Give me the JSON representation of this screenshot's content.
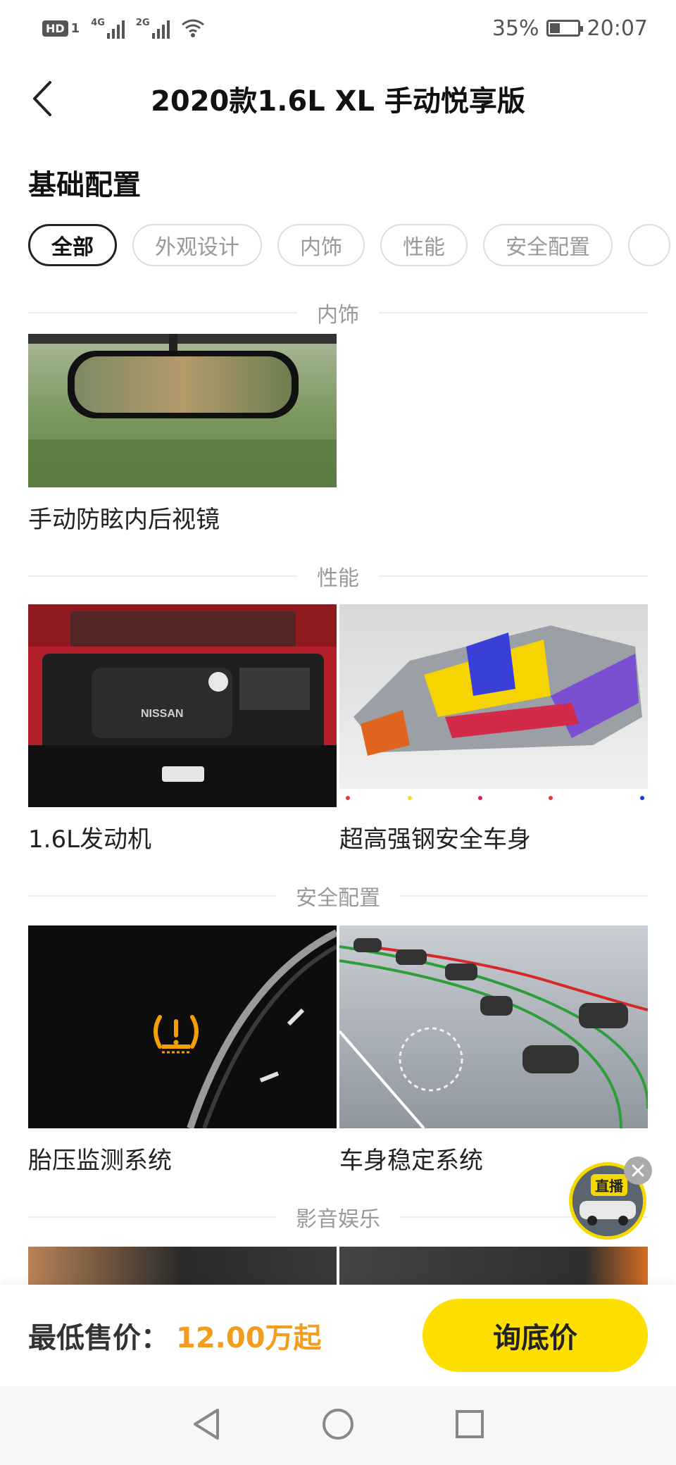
{
  "status_bar": {
    "hd": "HD",
    "sim1": "1",
    "net1": "4G",
    "net2": "2G",
    "battery": "35%",
    "time": "20:07"
  },
  "header": {
    "title": "2020款1.6L XL 手动悦享版"
  },
  "section": {
    "title": "基础配置"
  },
  "tabs": [
    {
      "label": "全部",
      "active": true
    },
    {
      "label": "外观设计"
    },
    {
      "label": "内饰"
    },
    {
      "label": "性能"
    },
    {
      "label": "安全配置"
    }
  ],
  "groups": {
    "interior": {
      "label": "内饰",
      "items": [
        {
          "caption": "手动防眩内后视镜"
        }
      ]
    },
    "performance": {
      "label": "性能",
      "items": [
        {
          "caption": "1.6L发动机",
          "brand_text": "NISSAN"
        },
        {
          "caption": "超高强钢安全车身"
        }
      ]
    },
    "safety": {
      "label": "安全配置",
      "items": [
        {
          "caption": "胎压监测系统"
        },
        {
          "caption": "车身稳定系统"
        }
      ]
    },
    "media": {
      "label": "影音娱乐"
    }
  },
  "live": {
    "label": "直播"
  },
  "bottom_bar": {
    "price_label": "最低售价：",
    "price_value": "12.00万起",
    "cta": "询底价"
  },
  "colors": {
    "accent_yellow": "#fde000",
    "price_orange": "#f29d1e"
  }
}
